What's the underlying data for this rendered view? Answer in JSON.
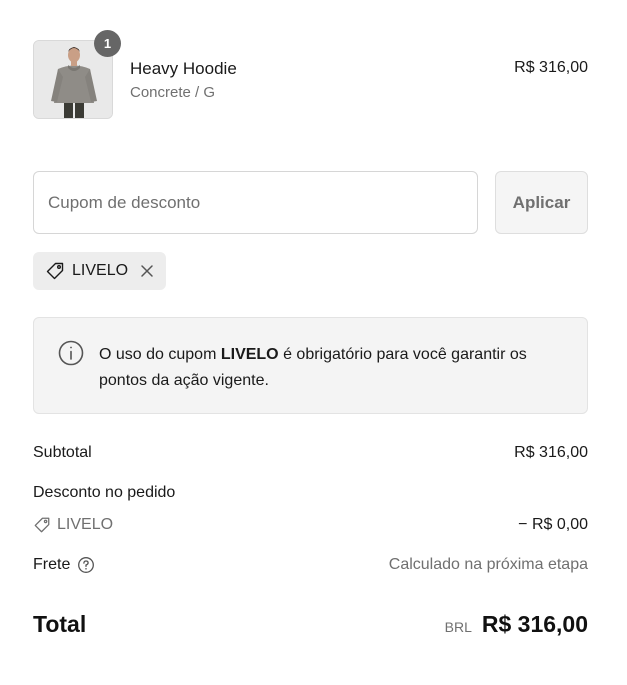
{
  "cart": {
    "product": {
      "name": "Heavy Hoodie",
      "variant": "Concrete / G",
      "price": "R$ 316,00",
      "quantity": "1",
      "image_icon": "hoodie-model-photo"
    }
  },
  "coupon": {
    "placeholder": "Cupom de desconto",
    "value": "",
    "apply_label": "Aplicar",
    "applied_code": "LIVELO"
  },
  "notice": {
    "text_before": "O uso do cupom ",
    "code": "LIVELO",
    "text_after": " é obrigatório para você garantir os pontos da ação vigente."
  },
  "summary": {
    "subtotal_label": "Subtotal",
    "subtotal_value": "R$ 316,00",
    "discount_label": "Desconto no pedido",
    "discount_code": "LIVELO",
    "discount_value": "− R$ 0,00",
    "shipping_label": "Frete",
    "shipping_value": "Calculado na próxima etapa",
    "total_label": "Total",
    "currency": "BRL",
    "total_value": "R$ 316,00"
  },
  "colors": {
    "badge": "#666666",
    "muted_text": "#707070",
    "notice_bg": "#f4f4f4",
    "chip_bg": "#ededed"
  }
}
